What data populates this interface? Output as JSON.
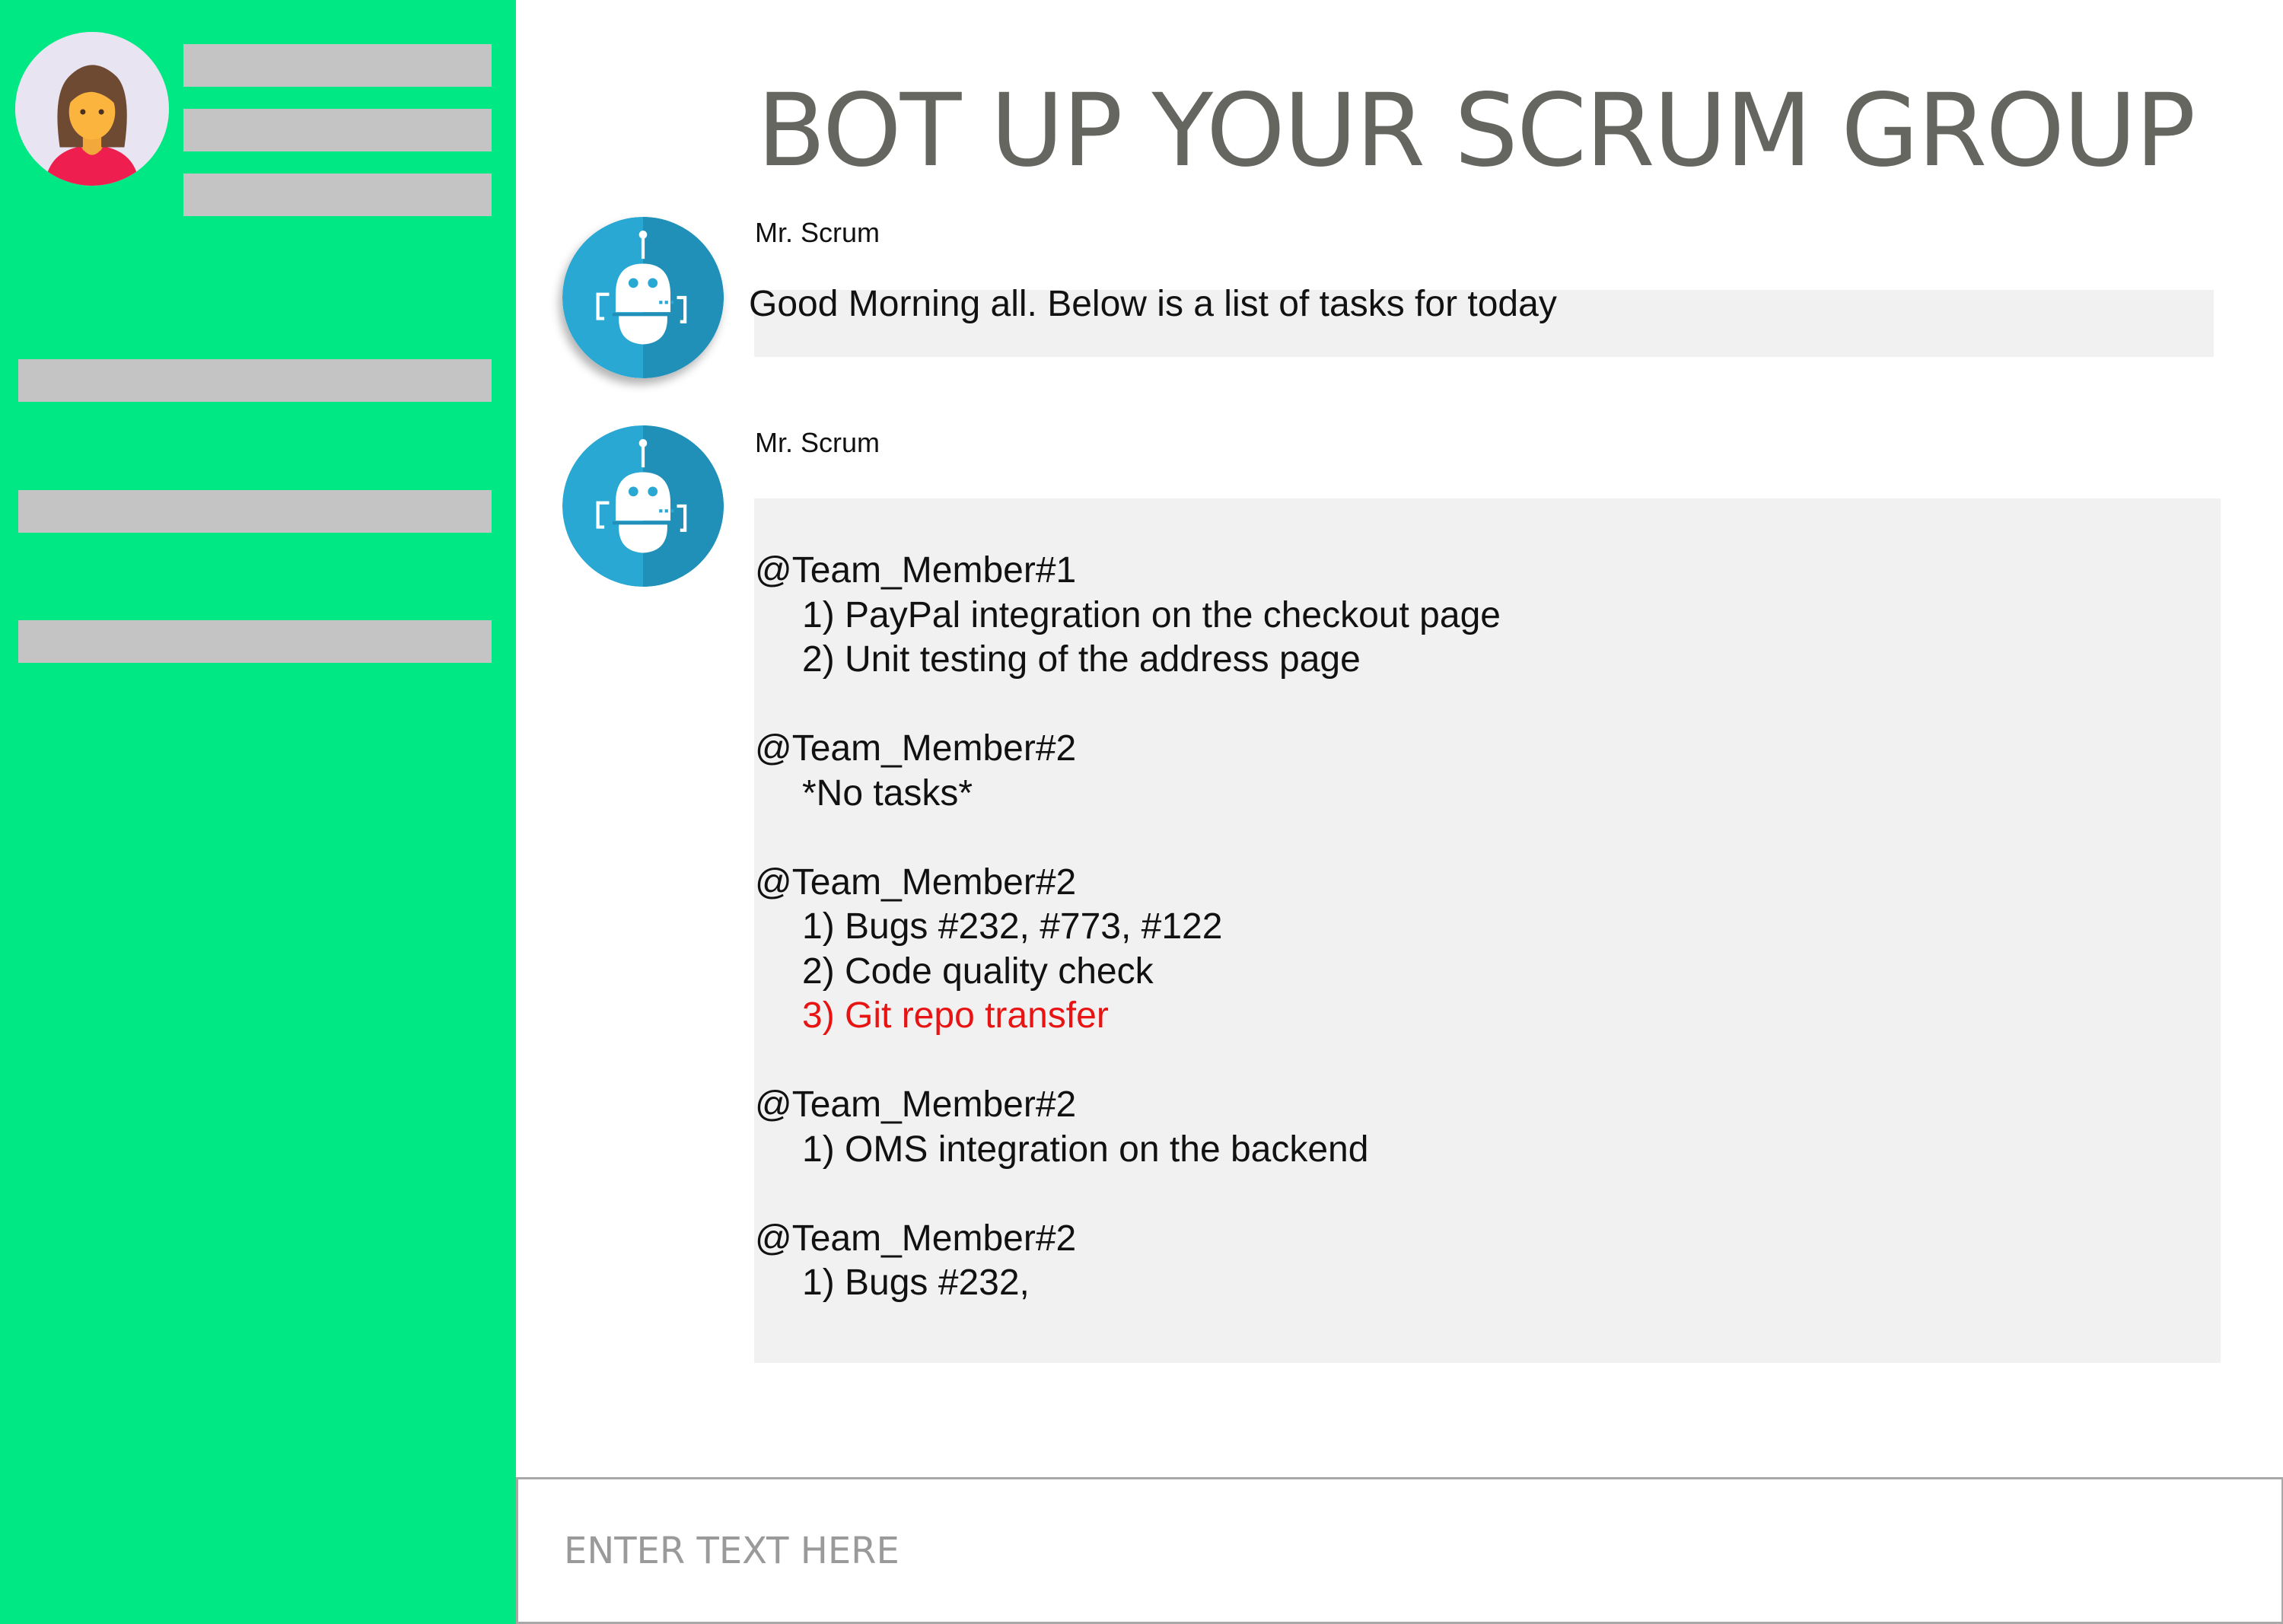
{
  "colors": {
    "sidebar": "#00e884",
    "placeholder_bar": "#c4c4c4",
    "bubble": "#f1f1f1",
    "title": "#666660",
    "alert_task": "#e81414",
    "bot_icon": "#29a8d4"
  },
  "sidebar": {
    "avatar_icon": "user-avatar-icon",
    "profile_lines": [
      "",
      "",
      ""
    ],
    "nav_items": [
      "",
      "",
      ""
    ]
  },
  "header": {
    "title": "BOT UP YOUR SCRUM GROUP"
  },
  "messages": [
    {
      "sender": "Mr. Scrum",
      "avatar_icon": "robot-icon",
      "text": "Good Morning all. Below is a list of tasks for today"
    },
    {
      "sender": "Mr. Scrum",
      "avatar_icon": "robot-icon",
      "task_groups": [
        {
          "member": "@Team_Member#1",
          "tasks": [
            {
              "text": "1) PayPal integration on the checkout page",
              "highlight": false
            },
            {
              "text": "2) Unit testing of the address page",
              "highlight": false
            }
          ]
        },
        {
          "member": "@Team_Member#2",
          "tasks": [
            {
              "text": "*No tasks*",
              "highlight": false
            }
          ]
        },
        {
          "member": "@Team_Member#2",
          "tasks": [
            {
              "text": "1) Bugs #232, #773, #122",
              "highlight": false
            },
            {
              "text": "2) Code quality check",
              "highlight": false
            },
            {
              "text": "3) Git repo transfer",
              "highlight": true
            }
          ]
        },
        {
          "member": "@Team_Member#2",
          "tasks": [
            {
              "text": "1) OMS integration on the backend",
              "highlight": false
            }
          ]
        },
        {
          "member": "@Team_Member#2",
          "tasks": [
            {
              "text": "1)  Bugs #232,",
              "highlight": false
            }
          ]
        }
      ]
    }
  ],
  "input": {
    "placeholder": "ENTER TEXT HERE",
    "value": ""
  }
}
